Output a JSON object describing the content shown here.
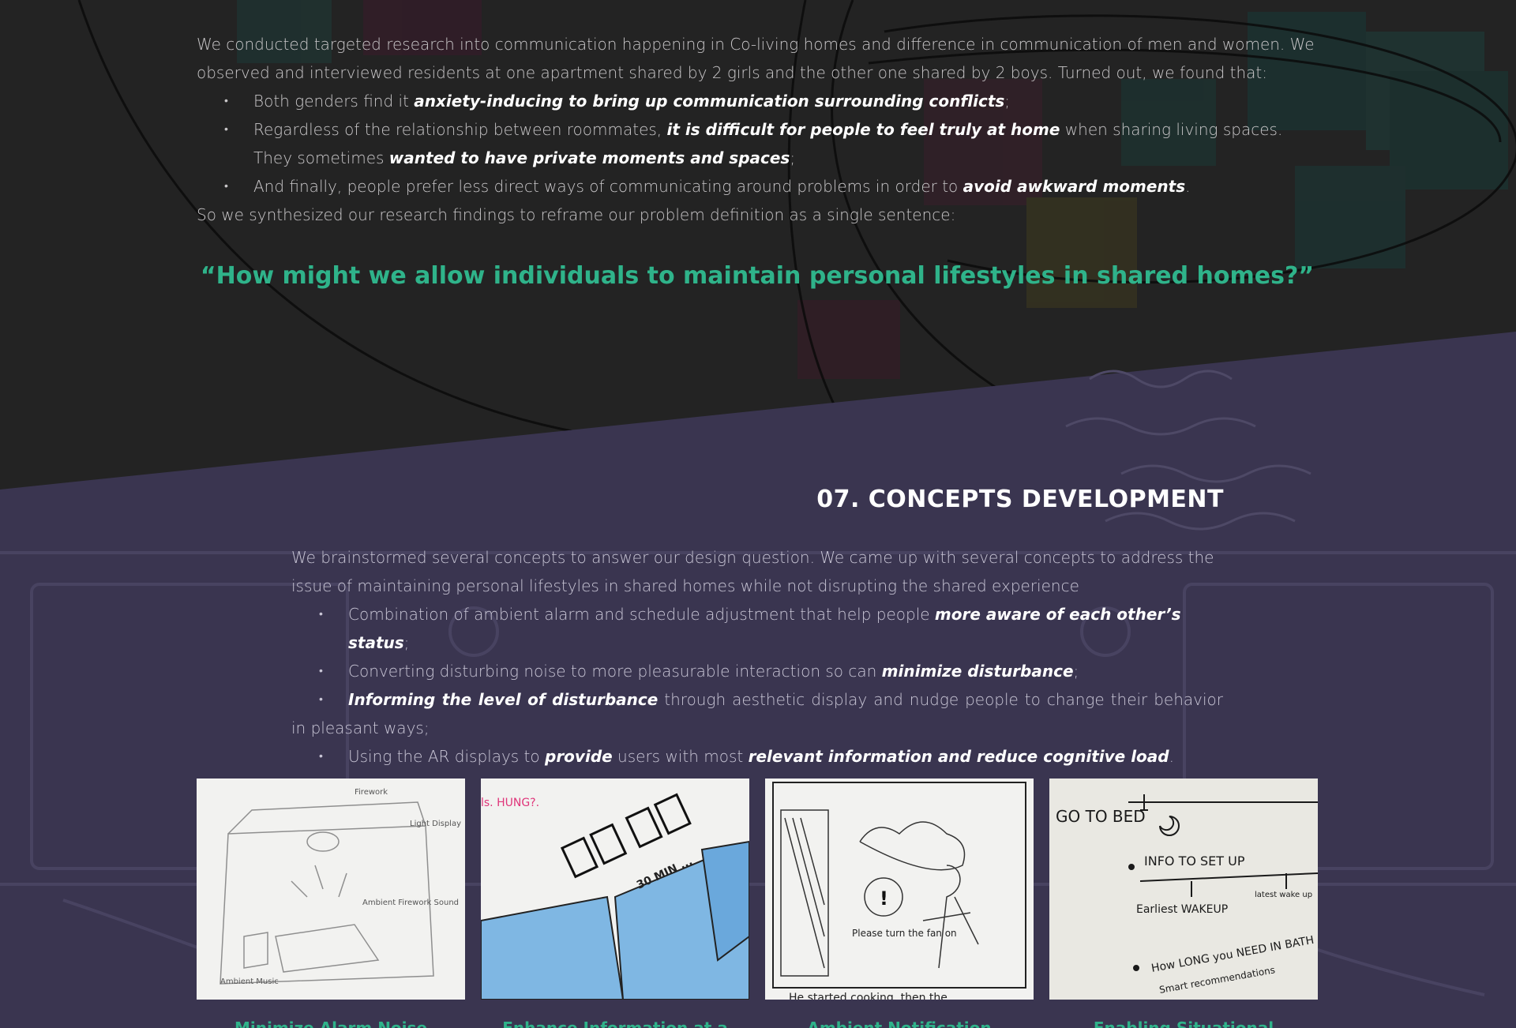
{
  "intro": {
    "paragraph": "We conducted targeted research into communication happening in Co-living homes and difference in communication of men and women. We observed and interviewed residents at one apartment shared by 2 girls and the other one shared by 2 boys. Turned out, we found that:",
    "bullets": [
      {
        "pre": "Both genders find it ",
        "em": "anxiety-inducing to bring up communication surrounding conflicts",
        "post": ";"
      },
      {
        "pre": "Regardless of the relationship between roommates, ",
        "em": "it is difficult for people to feel truly at home",
        "mid": " when sharing living spaces. They sometimes ",
        "em2": "wanted to have private moments and spaces",
        "post": ";"
      },
      {
        "pre": "And finally, people prefer less direct ways of communicating around problems in order to ",
        "em": "avoid awkward moments",
        "post": "."
      }
    ],
    "closing": "So we synthesized our research findings to reframe our problem definition as a single sentence:"
  },
  "quote": "“How might we allow individuals to maintain personal lifestyles in shared homes?”",
  "section": {
    "title": "07. CONCEPTS DEVELOPMENT",
    "paragraph": "We brainstormed several concepts to answer our design question. We came up with several concepts to address the issue of maintaining personal lifestyles in shared homes while not disrupting the shared experience",
    "bullets": [
      {
        "pre": "Combination of ambient alarm and schedule adjustment that help people ",
        "em": "more aware of each other’s status",
        "post": ";"
      },
      {
        "pre": "Converting disturbing noise to more pleasurable interaction so can ",
        "em": "minimize disturbance",
        "post": ";"
      },
      {
        "pre": "",
        "em": "Informing the level of disturbance",
        "post": " through aesthetic display and nudge people to change their behavior in pleasant ways;"
      },
      {
        "pre": "Using the AR displays to ",
        "em": "provide",
        "mid": " users with most ",
        "em2": "relevant information and reduce cognitive load",
        "post": "."
      }
    ]
  },
  "sketches": {
    "s1": {
      "labels": [
        "Ambient Firework Sound",
        "Light Display",
        "Firework",
        "Ambient Music"
      ]
    },
    "s2": {
      "labels": [
        "30 MIN ...",
        "ls. HUNG?."
      ]
    },
    "s3": {
      "labels": [
        "Please turn the fan on",
        "He started cooking, then the"
      ]
    },
    "s4": {
      "labels": [
        "GO TO BED",
        "INFO TO SET UP",
        "Earliest WAKEUP",
        "latest wake up",
        "How LONG you NEED IN BATH",
        "Smart recommendations"
      ]
    }
  },
  "captions": [
    "Minimize Alarm Noise",
    "Enhance Information at a",
    "Ambient Notification",
    "Enabling Situational"
  ]
}
